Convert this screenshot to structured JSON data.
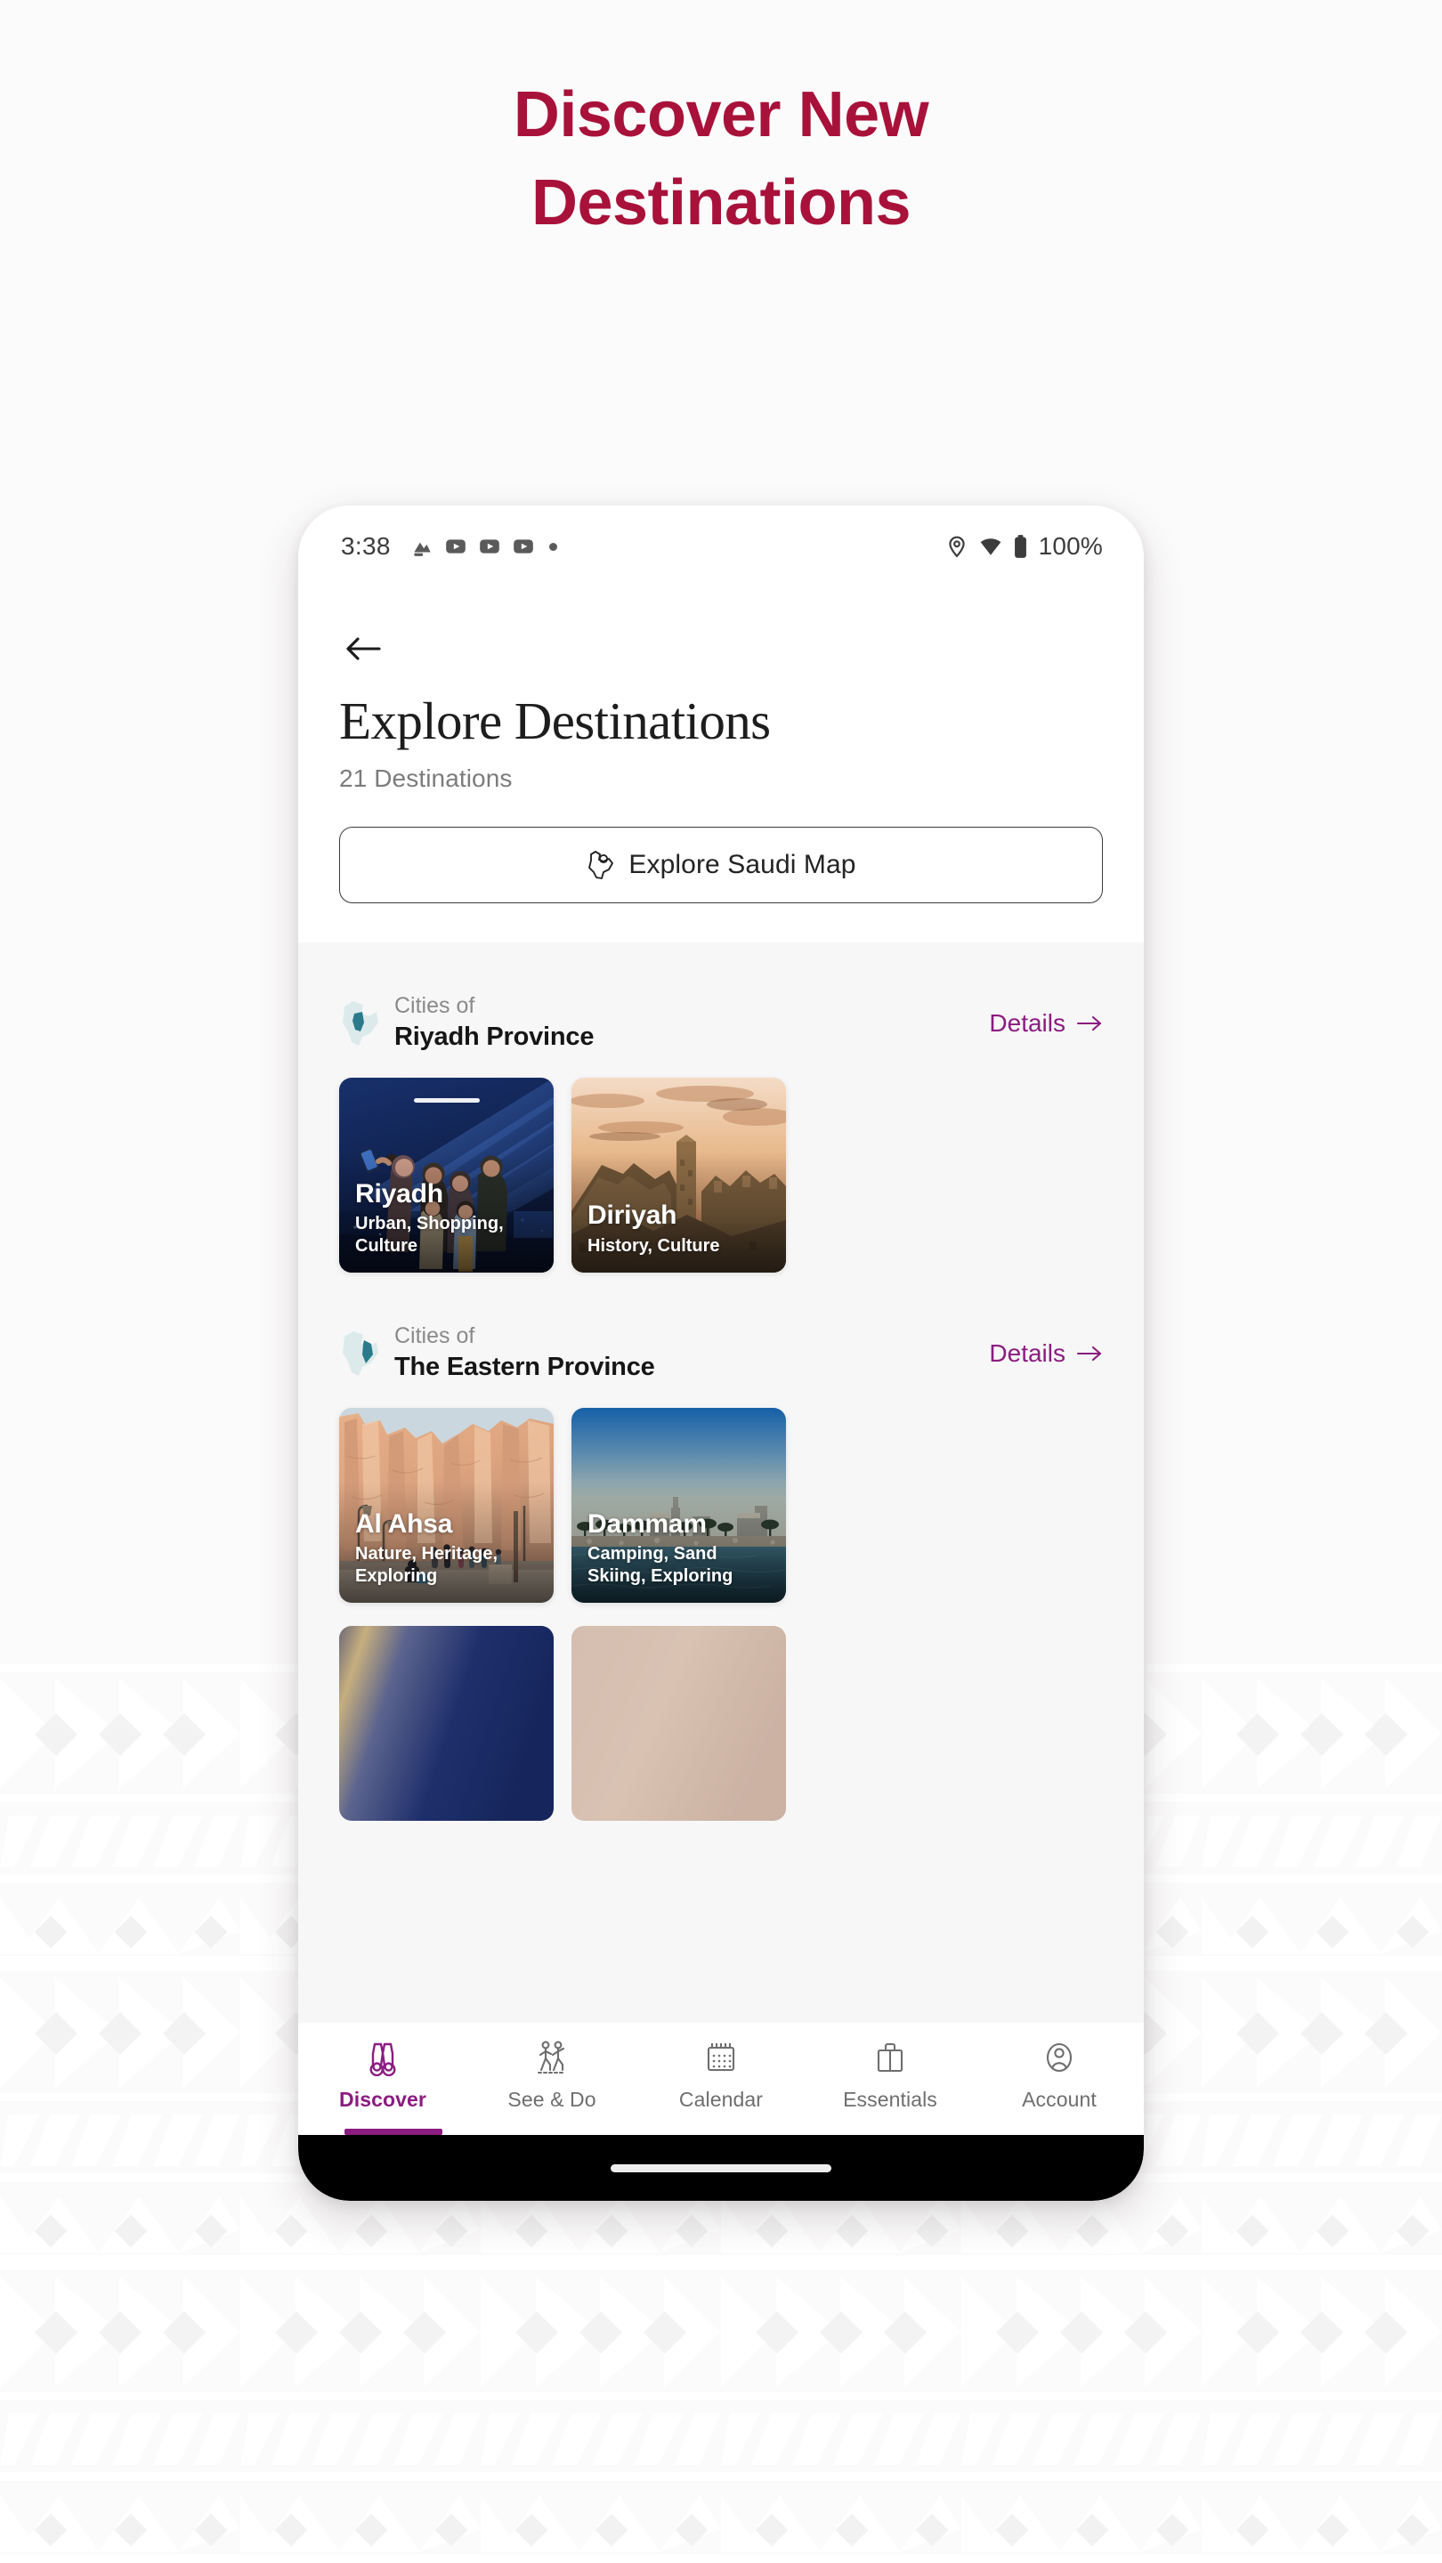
{
  "hero": {
    "headline_line1": "Discover New",
    "headline_line2": "Destinations",
    "headline_color": "#A8123A"
  },
  "status_bar": {
    "time": "3:38",
    "battery_percent": "100%",
    "icons": [
      "screenshot-icon",
      "youtube-icon",
      "youtube-icon",
      "youtube-icon",
      "dot-icon",
      "location-icon",
      "wifi-icon",
      "battery-icon"
    ]
  },
  "header": {
    "back_label": "Back",
    "title": "Explore Destinations",
    "count_label": "21 Destinations",
    "map_button_label": "Explore Saudi Map"
  },
  "sections": [
    {
      "kicker": "Cities of",
      "name": "Riyadh Province",
      "details_label": "Details",
      "cards": [
        {
          "title": "Riyadh",
          "tags": "Urban, Shopping, Culture",
          "art": "night-light-show-family-selfie",
          "has_drag_pill": true
        },
        {
          "title": "Diriyah",
          "tags": "History, Culture",
          "art": "mudbrick-ruins-sunset",
          "has_drag_pill": false
        }
      ]
    },
    {
      "kicker": "Cities of",
      "name": "The Eastern Province",
      "details_label": "Details",
      "cards": [
        {
          "title": "Al Ahsa",
          "tags": "Nature, Heritage, Exploring",
          "art": "sandstone-cliffs-visitors",
          "has_drag_pill": false
        },
        {
          "title": "Dammam",
          "tags": "Camping, Sand Skiing, Exploring",
          "art": "corniche-waterfront-palms",
          "has_drag_pill": false
        }
      ]
    }
  ],
  "peek_cards": [
    {
      "art": "navy-gold-gradient"
    },
    {
      "art": "beige-tan-gradient"
    }
  ],
  "tabbar": {
    "items": [
      {
        "label": "Discover",
        "icon": "binoculars-icon",
        "active": true
      },
      {
        "label": "See & Do",
        "icon": "walking-people-icon",
        "active": false
      },
      {
        "label": "Calendar",
        "icon": "calendar-icon",
        "active": false
      },
      {
        "label": "Essentials",
        "icon": "briefcase-icon",
        "active": false
      },
      {
        "label": "Account",
        "icon": "person-circle-icon",
        "active": false
      }
    ]
  },
  "colors": {
    "brand_red": "#A8123A",
    "accent_purple": "#8B1C80",
    "map_teal": "#2B7A8C",
    "body_bg": "#F7F7F7"
  }
}
